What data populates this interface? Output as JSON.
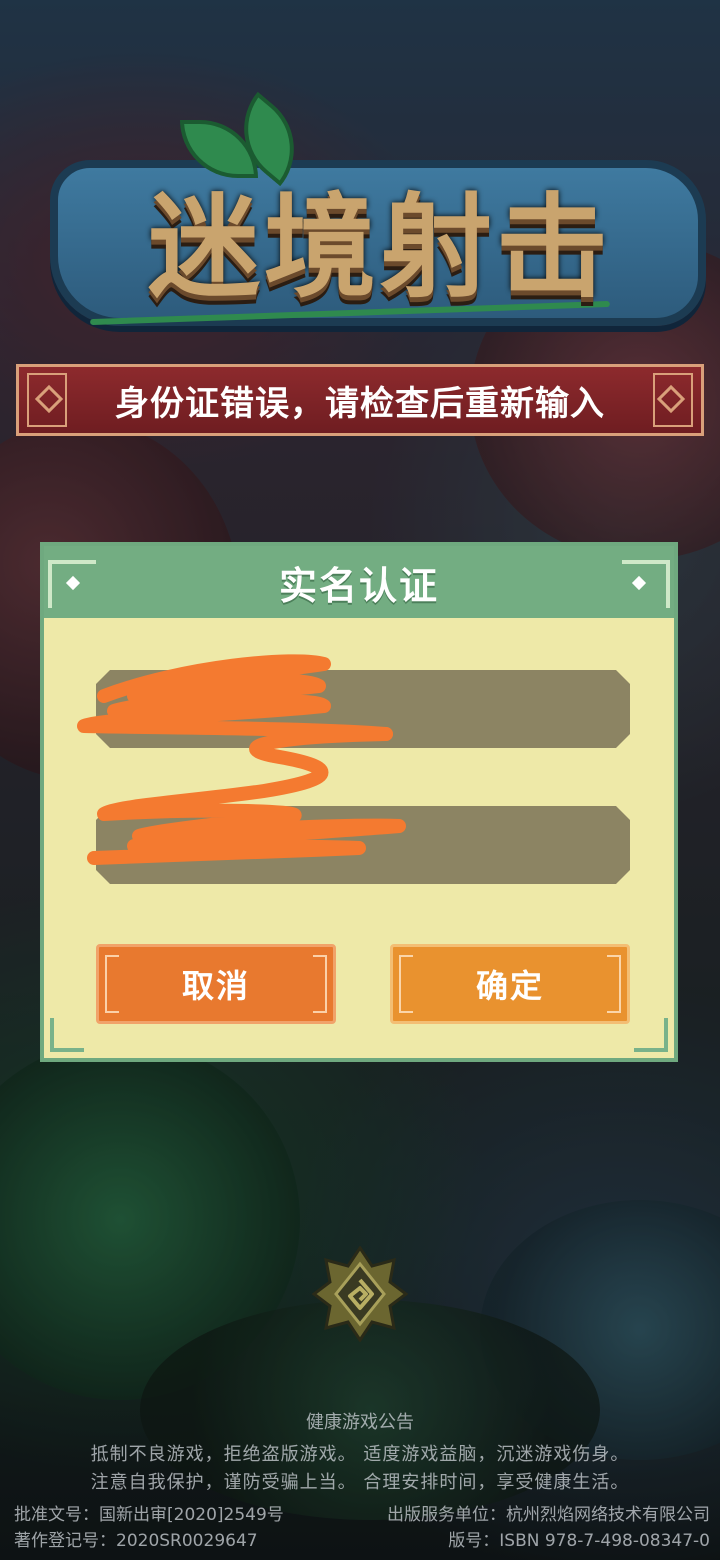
{
  "game": {
    "logo_title": "迷境射击"
  },
  "error_banner": {
    "message": "身份证错误，请检查后重新输入"
  },
  "dialog": {
    "title": "实名认证",
    "name_field_value": "",
    "id_field_value": "",
    "cancel_label": "取消",
    "confirm_label": "确定"
  },
  "footer": {
    "notice_title": "健康游戏公告",
    "notice_line1": "抵制不良游戏，拒绝盗版游戏。  适度游戏益脑，沉迷游戏伤身。",
    "notice_line2": "注意自我保护，谨防受骗上当。  合理安排时间，享受健康生活。",
    "approval_no": "批准文号：国新出审[2020]2549号",
    "copyright_no": "著作登记号：2020SR0029647",
    "publisher": "出版服务单位：杭州烈焰网络技术有限公司",
    "isbn": "版号：ISBN 978-7-498-08347-0"
  },
  "colors": {
    "banner_bg": "#8d2a2d",
    "dialog_bg": "#eee9a8",
    "dialog_header": "#73ad82",
    "field_bg": "#8c8463",
    "cancel_button": "#e8792f",
    "confirm_button": "#e9922f",
    "redaction_scribble": "#f47a30"
  },
  "icons": {
    "emblem": "spiral-emblem-icon"
  }
}
